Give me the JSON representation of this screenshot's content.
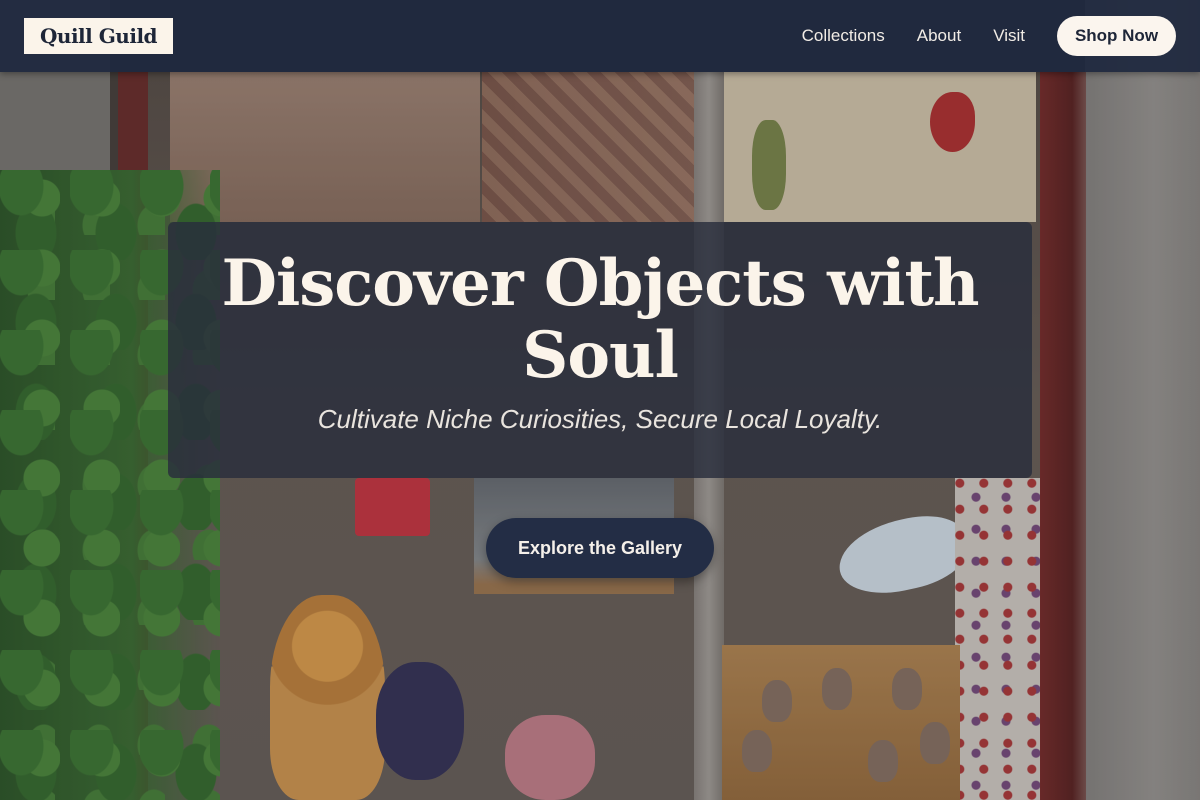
{
  "brand": {
    "name": "Quill Guild"
  },
  "nav": {
    "links": [
      "Collections",
      "About",
      "Visit"
    ],
    "cta_label": "Shop Now"
  },
  "hero": {
    "title": "Discover Objects with Soul",
    "subtitle": "Cultivate Niche Curiosities, Secure Local Loyalty.",
    "cta_label": "Explore the Gallery",
    "background_image": "shop window with ivy, plush lion and elephant toys, bird prints and animal-head wall hooks"
  },
  "colors": {
    "navy": "#1e2638",
    "cream": "#fbf4ea",
    "frame_red": "#6d2f2d"
  }
}
